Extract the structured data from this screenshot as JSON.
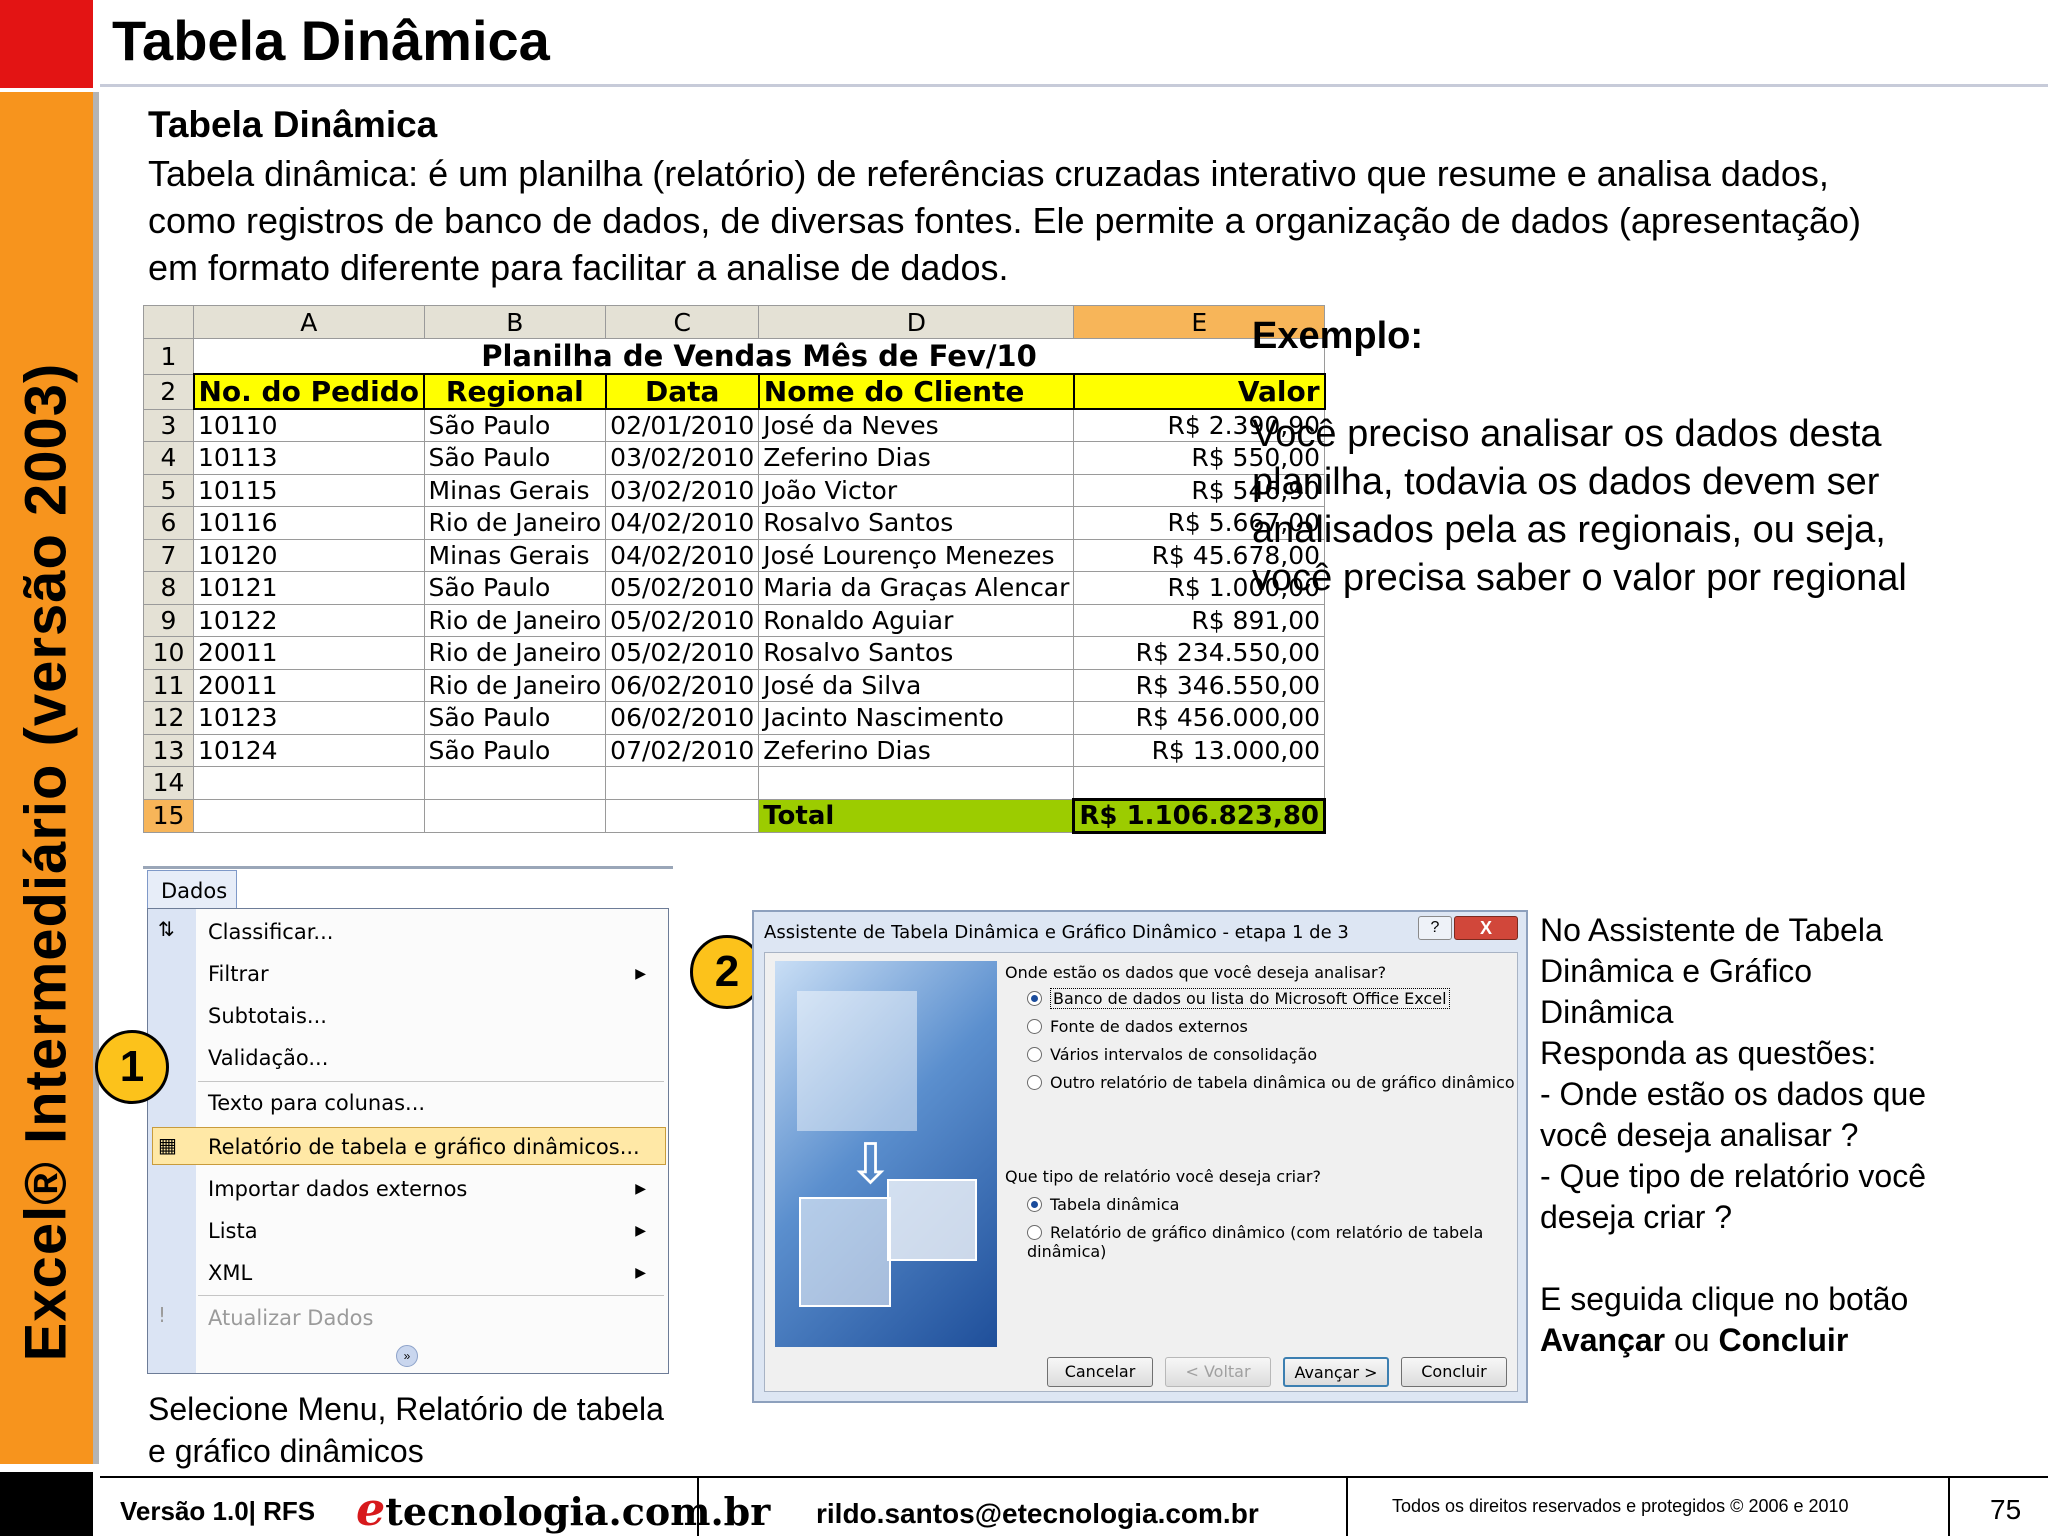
{
  "side_title": "Excel® Intermediário (versão 2003)",
  "header": {
    "title": "Tabela Dinâmica"
  },
  "section": {
    "title": "Tabela Dinâmica",
    "intro_lines": [
      "Tabela dinâmica: é um planilha (relatório) de referências cruzadas interativo que resume e analisa dados,",
      "como registros de banco de dados, de diversas fontes. Ele permite a organização de dados (apresentação)",
      "em formato diferente para facilitar a analise de dados."
    ]
  },
  "spreadsheet": {
    "columns": [
      "A",
      "B",
      "C",
      "D",
      "E"
    ],
    "title": "Planilha de Vendas Mês de Fev/10",
    "headers": [
      "No. do Pedido",
      "Regional",
      "Data",
      "Nome do Cliente",
      "Valor"
    ],
    "rows": [
      [
        "10110",
        "São Paulo",
        "02/01/2010",
        "José da Neves",
        "R$ 2.390,90"
      ],
      [
        "10113",
        "São Paulo",
        "03/02/2010",
        "Zeferino Dias",
        "R$ 550,00"
      ],
      [
        "10115",
        "Minas Gerais",
        "03/02/2010",
        "João Victor",
        "R$ 546,90"
      ],
      [
        "10116",
        "Rio de Janeiro",
        "04/02/2010",
        "Rosalvo Santos",
        "R$ 5.667,00"
      ],
      [
        "10120",
        "Minas Gerais",
        "04/02/2010",
        "José Lourenço Menezes",
        "R$ 45.678,00"
      ],
      [
        "10121",
        "São Paulo",
        "05/02/2010",
        "Maria da Graças Alencar",
        "R$ 1.000,00"
      ],
      [
        "10122",
        "Rio de Janeiro",
        "05/02/2010",
        "Ronaldo Aguiar",
        "R$ 891,00"
      ],
      [
        "20011",
        "Rio de Janeiro",
        "05/02/2010",
        "Rosalvo Santos",
        "R$ 234.550,00"
      ],
      [
        "20011",
        "Rio de Janeiro",
        "06/02/2010",
        "José da Silva",
        "R$ 346.550,00"
      ],
      [
        "10123",
        "São Paulo",
        "06/02/2010",
        "Jacinto Nascimento",
        "R$ 456.000,00"
      ],
      [
        "10124",
        "São Paulo",
        "07/02/2010",
        "Zeferino Dias",
        "R$ 13.000,00"
      ]
    ],
    "total_label": "Total",
    "total_value": "R$ 1.106.823,80"
  },
  "example": {
    "title": "Exemplo:",
    "lines": [
      "Você preciso analisar os dados desta",
      "planilha, todavia os dados devem ser",
      "analisados pela as regionais, ou seja,",
      "você precisa saber o valor por  regional"
    ]
  },
  "menu": {
    "tab": "Dados",
    "items": [
      {
        "label": "Classificar...",
        "submenu": false,
        "icon": "sort-az-icon"
      },
      {
        "label": "Filtrar",
        "submenu": true
      },
      {
        "label": "Subtotais...",
        "submenu": false
      },
      {
        "label": "Validação...",
        "submenu": false
      },
      {
        "label": "Texto para colunas...",
        "submenu": false
      },
      {
        "label": "Relatório de tabela e gráfico dinâmicos...",
        "submenu": false,
        "highlighted": true,
        "icon": "pivot-table-icon"
      },
      {
        "label": "Importar dados externos",
        "submenu": true
      },
      {
        "label": "Lista",
        "submenu": true
      },
      {
        "label": "XML",
        "submenu": true
      },
      {
        "label": "Atualizar Dados",
        "submenu": false,
        "disabled": true,
        "icon": "refresh-icon"
      }
    ],
    "caption_lines": [
      "Selecione Menu, Relatório de tabela",
      "e gráfico dinâmicos"
    ]
  },
  "badges": {
    "one": "1",
    "two": "2"
  },
  "wizard": {
    "title": "Assistente de Tabela Dinâmica e Gráfico Dinâmico - etapa 1 de 3",
    "help": "?",
    "close": "X",
    "q1": "Onde estão os dados que você deseja analisar?",
    "q1_options": [
      "Banco de dados ou lista do Microsoft Office Excel",
      "Fonte de dados externos",
      "Vários intervalos de consolidação",
      "Outro relatório de tabela dinâmica ou de gráfico dinâmico"
    ],
    "q2": "Que tipo de relatório você deseja criar?",
    "q2_options": [
      "Tabela dinâmica",
      "Relatório de gráfico dinâmico (com relatório de tabela dinâmica)"
    ],
    "buttons": {
      "cancel": "Cancelar",
      "back": "< Voltar",
      "next": "Avançar >",
      "finish": "Concluir"
    }
  },
  "wizard_text": {
    "lines": [
      "No Assistente de Tabela",
      "Dinâmica e Gráfico",
      "Dinâmica",
      "Responda as questões:",
      "- Onde estão os dados que",
      "você deseja analisar ?",
      "- Que tipo de relatório você",
      "deseja criar ?"
    ],
    "final_prefix": "E seguida clique no botão",
    "btn1": "Avançar",
    "or": "ou",
    "btn2": "Concluir"
  },
  "footer": {
    "version": "Versão 1.0| RFS",
    "logo_e": "e",
    "logo_rest": "tecnologia.com.br",
    "email": "rildo.santos@etecnologia.com.br",
    "rights": "Todos os direitos reservados e protegidos © 2006 e 2010",
    "page": "75"
  }
}
